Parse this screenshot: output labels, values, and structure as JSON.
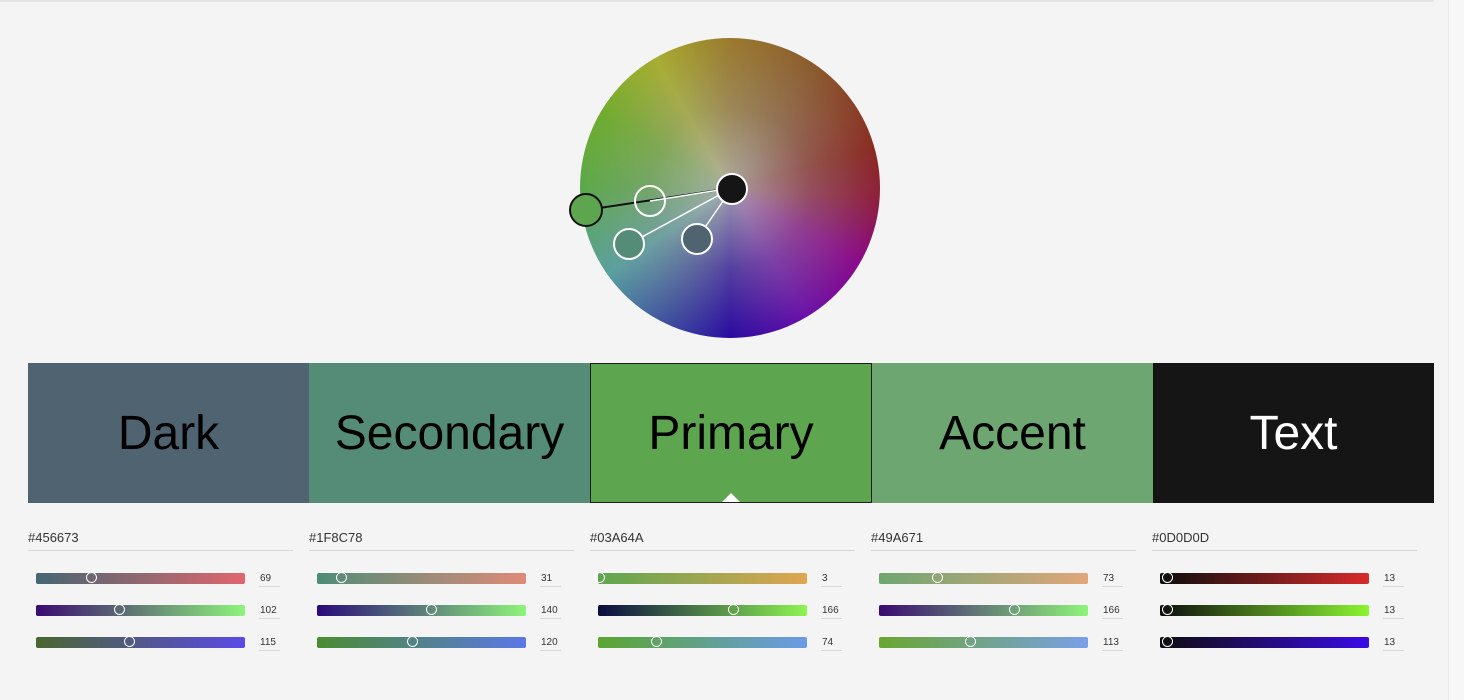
{
  "colors": {
    "dark": "#506370",
    "secondary": "#548C78",
    "primary": "#5DA64F",
    "accent": "#6EA672",
    "text": "#151515"
  },
  "wheel": {
    "nodes": [
      {
        "name": "primary-handle",
        "fill": "#5DA64F"
      },
      {
        "name": "text-handle",
        "fill": "#151515"
      },
      {
        "name": "accent-handle",
        "fill": "none"
      },
      {
        "name": "secondary-handle",
        "fill": "#548C78"
      },
      {
        "name": "dark-handle",
        "fill": "#506370"
      }
    ]
  },
  "swatches": [
    {
      "label": "Dark",
      "color": "#506370",
      "text_color": "#000000",
      "selected": false
    },
    {
      "label": "Secondary",
      "color": "#548C78",
      "text_color": "#000000",
      "selected": false
    },
    {
      "label": "Primary",
      "color": "#5DA64F",
      "text_color": "#000000",
      "selected": true
    },
    {
      "label": "Accent",
      "color": "#6EA672",
      "text_color": "#000000",
      "selected": false
    },
    {
      "label": "Text",
      "color": "#151515",
      "text_color": "#ffffff",
      "selected": false
    }
  ],
  "panels": [
    {
      "hex": "#456673",
      "sliders": [
        {
          "value": "69",
          "gradient": [
            "#456673",
            "#E0666E"
          ],
          "fraction": 0.27
        },
        {
          "value": "102",
          "gradient": [
            "#3A0A72",
            "#8EF57A"
          ],
          "fraction": 0.4
        },
        {
          "value": "115",
          "gradient": [
            "#4A6630",
            "#5A4AE8"
          ],
          "fraction": 0.45
        }
      ]
    },
    {
      "hex": "#1F8C78",
      "sliders": [
        {
          "value": "31",
          "gradient": [
            "#4E8C78",
            "#E08A78"
          ],
          "fraction": 0.12
        },
        {
          "value": "140",
          "gradient": [
            "#2A0A7A",
            "#8EF57A"
          ],
          "fraction": 0.55
        },
        {
          "value": "120",
          "gradient": [
            "#4A8C30",
            "#5A78E8"
          ],
          "fraction": 0.46
        }
      ]
    },
    {
      "hex": "#03A64A",
      "sliders": [
        {
          "value": "3",
          "gradient": [
            "#5DA64F",
            "#E0A650"
          ],
          "fraction": 0.01
        },
        {
          "value": "166",
          "gradient": [
            "#0A0A40",
            "#8EF550"
          ],
          "fraction": 0.65
        },
        {
          "value": "74",
          "gradient": [
            "#5AA630",
            "#6A9AE8"
          ],
          "fraction": 0.28
        }
      ]
    },
    {
      "hex": "#49A671",
      "sliders": [
        {
          "value": "73",
          "gradient": [
            "#6EA672",
            "#E0A67A"
          ],
          "fraction": 0.28
        },
        {
          "value": "166",
          "gradient": [
            "#3A0A72",
            "#8EF57A"
          ],
          "fraction": 0.65
        },
        {
          "value": "113",
          "gradient": [
            "#6AA630",
            "#78A0E8"
          ],
          "fraction": 0.44
        }
      ]
    },
    {
      "hex": "#0D0D0D",
      "sliders": [
        {
          "value": "13",
          "gradient": [
            "#0D0D0D",
            "#D92A2A"
          ],
          "fraction": 0.04
        },
        {
          "value": "13",
          "gradient": [
            "#0D0D0D",
            "#8AF530"
          ],
          "fraction": 0.04
        },
        {
          "value": "13",
          "gradient": [
            "#0D0D0D",
            "#3A0AE8"
          ],
          "fraction": 0.04
        }
      ]
    }
  ]
}
